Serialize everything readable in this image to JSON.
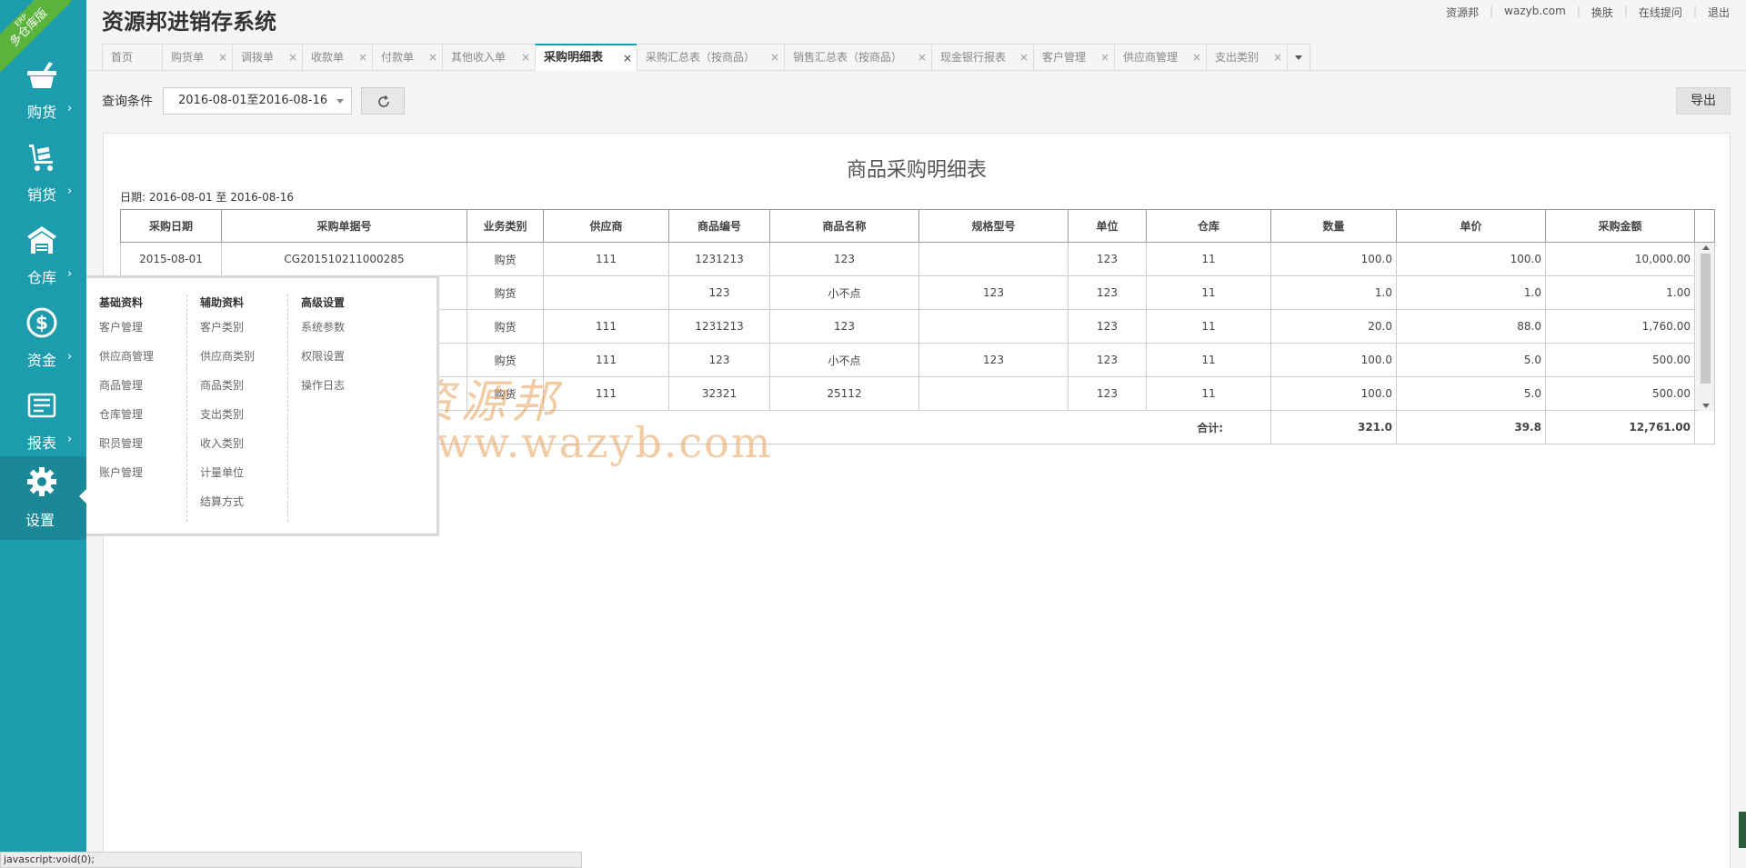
{
  "app": {
    "title": "资源邦进销存系统",
    "badge_top": "ERP",
    "badge_main": "多仓库版"
  },
  "top_links": [
    "资源邦",
    "wazyb.com",
    "换肤",
    "在线提问",
    "退出"
  ],
  "sidebar": {
    "items": [
      {
        "label": "购货",
        "icon": "basket-icon"
      },
      {
        "label": "销货",
        "icon": "cart-icon"
      },
      {
        "label": "仓库",
        "icon": "warehouse-icon"
      },
      {
        "label": "资金",
        "icon": "dollar-icon"
      },
      {
        "label": "报表",
        "icon": "report-icon"
      },
      {
        "label": "设置",
        "icon": "gear-icon"
      }
    ],
    "chevron": "›"
  },
  "tabs": [
    {
      "label": "首页",
      "closable": false
    },
    {
      "label": "购货单",
      "closable": true
    },
    {
      "label": "调拨单",
      "closable": true
    },
    {
      "label": "收款单",
      "closable": true
    },
    {
      "label": "付款单",
      "closable": true
    },
    {
      "label": "其他收入单",
      "closable": true
    },
    {
      "label": "采购明细表",
      "closable": true,
      "active": true
    },
    {
      "label": "采购汇总表（按商品）",
      "closable": true
    },
    {
      "label": "销售汇总表（按商品）",
      "closable": true
    },
    {
      "label": "现金银行报表",
      "closable": true
    },
    {
      "label": "客户管理",
      "closable": true
    },
    {
      "label": "供应商管理",
      "closable": true
    },
    {
      "label": "支出类别",
      "closable": true
    }
  ],
  "query": {
    "label": "查询条件",
    "date_range": "2016-08-01至2016-08-16",
    "export_label": "导出"
  },
  "report": {
    "title": "商品采购明细表",
    "date_line": "日期: 2016-08-01 至 2016-08-16",
    "columns": [
      "采购日期",
      "采购单据号",
      "业务类别",
      "供应商",
      "商品编号",
      "商品名称",
      "规格型号",
      "单位",
      "仓库",
      "数量",
      "单价",
      "采购金额"
    ],
    "rows": [
      [
        "2015-08-01",
        "CG201510211000285",
        "购货",
        "111",
        "1231213",
        "123",
        "",
        "123",
        "11",
        "100.0",
        "100.0",
        "10,000.00"
      ],
      [
        "",
        "",
        "购货",
        "",
        "123",
        "小不点",
        "123",
        "123",
        "11",
        "1.0",
        "1.0",
        "1.00"
      ],
      [
        "",
        "",
        "购货",
        "111",
        "1231213",
        "123",
        "",
        "123",
        "11",
        "20.0",
        "88.0",
        "1,760.00"
      ],
      [
        "",
        "",
        "购货",
        "111",
        "123",
        "小不点",
        "123",
        "123",
        "11",
        "100.0",
        "5.0",
        "500.00"
      ],
      [
        "",
        "",
        "购货",
        "111",
        "32321",
        "25112",
        "",
        "123",
        "11",
        "100.0",
        "5.0",
        "500.00"
      ]
    ],
    "total": {
      "label": "合计:",
      "qty": "321.0",
      "price": "39.8",
      "amount": "12,761.00"
    }
  },
  "watermark": {
    "line1": "资源邦",
    "line2": "www.wazyb.com"
  },
  "flyout": {
    "columns": [
      {
        "heading": "基础资料",
        "items": [
          "客户管理",
          "供应商管理",
          "商品管理",
          "仓库管理",
          "职员管理",
          "账户管理"
        ]
      },
      {
        "heading": "辅助资料",
        "items": [
          "客户类别",
          "供应商类别",
          "商品类别",
          "支出类别",
          "收入类别",
          "计量单位",
          "结算方式"
        ]
      },
      {
        "heading": "高级设置",
        "items": [
          "系统参数",
          "权限设置",
          "操作日志"
        ]
      }
    ]
  },
  "status_bar": "javascript:void(0);",
  "colors": {
    "sidebar": "#1d9cad",
    "sidebar_active": "#1a8896",
    "ribbon": "#5ab33b"
  }
}
